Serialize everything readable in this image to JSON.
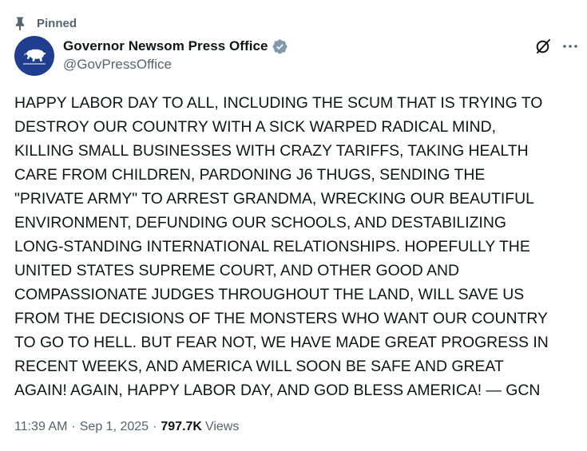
{
  "pinned": {
    "label": "Pinned",
    "icon": "pin-icon"
  },
  "author": {
    "display_name": "Governor Newsom Press Office",
    "handle": "@GovPressOffice",
    "verified_icon": "verified-badge-icon",
    "avatar_icon": "california-bear-icon",
    "avatar_color": "#1f3e8f"
  },
  "actions": {
    "grok_icon": "grok-icon",
    "more_icon": "more-icon"
  },
  "tweet": {
    "lines": [
      "HAPPY LABOR DAY TO ALL, INCLUDING THE SCUM THAT IS TRYING TO",
      "DESTROY OUR COUNTRY WITH A SICK WARPED RADICAL MIND,",
      "KILLING SMALL BUSINESSES WITH CRAZY TARIFFS, TAKING HEALTH",
      "CARE FROM CHILDREN, PARDONING J6 THUGS, SENDING THE",
      "\"PRIVATE ARMY\" TO ARREST GRANDMA, WRECKING OUR BEAUTIFUL",
      "ENVIRONMENT, DEFUNDING OUR SCHOOLS, AND DESTABILIZING",
      "LONG-STANDING INTERNATIONAL RELATIONSHIPS. HOPEFULLY THE",
      "UNITED STATES SUPREME COURT, AND OTHER GOOD AND",
      "COMPASSIONATE JUDGES THROUGHOUT THE LAND, WILL SAVE US",
      "FROM THE DECISIONS OF THE MONSTERS WHO WANT OUR COUNTRY",
      "TO GO TO HELL. BUT FEAR NOT, WE HAVE MADE GREAT PROGRESS IN",
      "RECENT WEEKS, AND AMERICA WILL SOON BE SAFE AND GREAT",
      "AGAIN! AGAIN, HAPPY LABOR DAY, AND GOD BLESS AMERICA! — GCN"
    ]
  },
  "meta": {
    "time": "11:39 AM",
    "separator": "·",
    "date": "Sep 1, 2025",
    "views_count": "797.7K",
    "views_label": "Views"
  },
  "colors": {
    "text_primary": "#0f1419",
    "text_secondary": "#536471",
    "verified": "#829aab"
  }
}
